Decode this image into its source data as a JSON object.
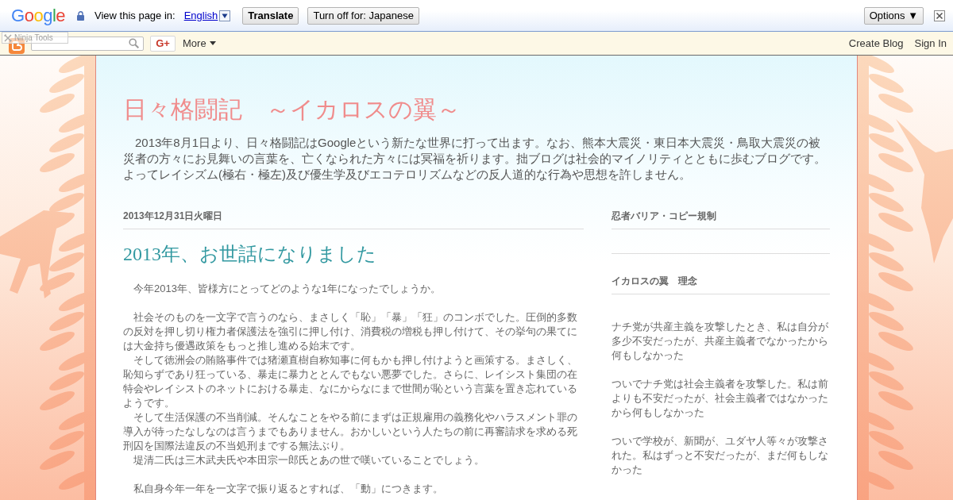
{
  "translate_bar": {
    "logo": "Google",
    "prompt": "View this page in:",
    "language_link": "English",
    "translate_button": "Translate",
    "turn_off_button": "Turn off for: Japanese",
    "options_button": "Options ▼"
  },
  "navbar": {
    "badge": "Ninja Tools",
    "gplus_button": "G+",
    "more_menu": "More",
    "links": [
      "Create Blog",
      "Sign In"
    ]
  },
  "header": {
    "title": "日々格闘記　～イカロスの翼～",
    "description": "2013年8月1日より、日々格闘記はGoogleという新たな世界に打って出ます。なお、熊本大震災・東日本大震災・鳥取大震災の被災者の方々にお見舞いの言葉を、亡くなられた方々には冥福を祈ります。拙ブログは社会的マイノリティとともに歩むブログです。よってレイシズム(極右・極左)及び優生学及びエコテロリズムなどの反人道的な行為や思想を許しません。"
  },
  "post": {
    "date": "2013年12月31日火曜日",
    "title": "2013年、お世話になりました",
    "sections": [
      {
        "paragraphs": [
          "今年2013年、皆様方にとってどのような1年になったでしょうか。"
        ]
      },
      {
        "paragraphs": [
          "社会そのものを一文字で言うのなら、まさしく「恥」「暴」「狂」のコンボでした。圧倒的多数の反対を押し切り権力者保護法を強引に押し付け、消費税の増税も押し付けて、その挙句の果てには大金持ち優遇政策をもっと推し進める始末です。",
          "そして徳洲会の賄賂事件では猪瀬直樹自称知事に何もかも押し付けようと画策する。まさしく、恥知らずであり狂っている、暴走に暴力ととんでもない悪夢でした。さらに、レイシスト集団の在特会やレイシストのネットにおける暴走、なにからなにまで世間が恥という言葉を置き忘れているようです。",
          "そして生活保護の不当削減。そんなことをやる前にまずは正規雇用の義務化やハラスメント罪の導入が待ったなしなのは言うまでもありません。おかしいという人たちの前に再審請求を求める死刑囚を国際法違反の不当処刑までする無法ぶり。",
          "堤清二氏は三木武夫氏や本田宗一郎氏とあの世で嘆いていることでしょう。"
        ]
      },
      {
        "paragraphs": [
          "私自身今年一年を一文字で振り返るとすれば、「動」につきます。"
        ]
      }
    ]
  },
  "sidebar": {
    "widgets": [
      {
        "title": "忍者バリア・コピー規制"
      },
      {
        "title": "イカロスの翼　理念",
        "paragraphs": [
          "ナチ党が共産主義を攻撃したとき、私は自分が多少不安だったが、共産主義者でなかったから何もしなかった",
          "ついでナチ党は社会主義者を攻撃した。私は前よりも不安だったが、社会主義者ではなかったから何もしなかった",
          "ついで学校が、新聞が、ユダヤ人等々が攻撃された。私はずっと不安だったが、まだ何もしなかった"
        ]
      }
    ]
  }
}
